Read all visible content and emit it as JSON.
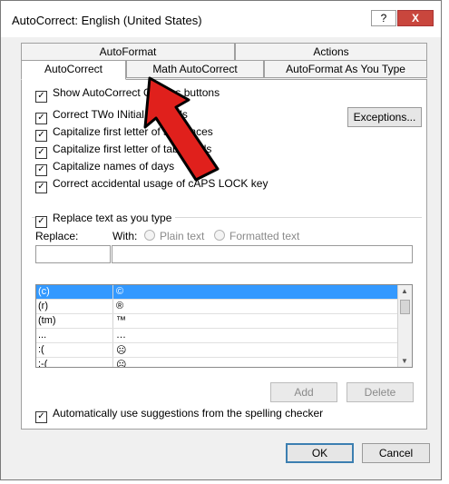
{
  "window": {
    "title": "AutoCorrect: English (United States)",
    "help_label": "?",
    "close_label": "X"
  },
  "tabs": {
    "back_row": [
      {
        "label": "AutoFormat"
      },
      {
        "label": "Actions"
      }
    ],
    "front_row": [
      {
        "label": "AutoCorrect"
      },
      {
        "label": "Math AutoCorrect"
      },
      {
        "label": "AutoFormat As You Type"
      }
    ]
  },
  "options": [
    {
      "label": "Show AutoCorrect Options buttons",
      "checked": true
    },
    {
      "label": "Correct TWo INitial CApitals",
      "checked": true
    },
    {
      "label": "Capitalize first letter of sentences",
      "checked": true
    },
    {
      "label": "Capitalize first letter of table cells",
      "checked": true
    },
    {
      "label": "Capitalize names of days",
      "checked": true
    },
    {
      "label": "Correct accidental usage of cAPS LOCK key",
      "checked": true
    }
  ],
  "exceptions_label": "Exceptions...",
  "replace_group": {
    "checkbox_label": "Replace text as you type",
    "checked": true,
    "replace_label": "Replace:",
    "with_label": "With:",
    "plain_text_label": "Plain text",
    "formatted_text_label": "Formatted text",
    "replace_value": "",
    "with_value": ""
  },
  "list_rows": [
    {
      "key": "(c)",
      "value": "©"
    },
    {
      "key": "(r)",
      "value": "®"
    },
    {
      "key": "(tm)",
      "value": "™"
    },
    {
      "key": "...",
      "value": "…"
    },
    {
      "key": ":(",
      "value": "☹"
    },
    {
      "key": ":-(",
      "value": "☹"
    }
  ],
  "buttons": {
    "add": "Add",
    "delete": "Delete",
    "ok": "OK",
    "cancel": "Cancel"
  },
  "spelling_checkbox": {
    "label": "Automatically use suggestions from the spelling checker",
    "checked": true
  },
  "colors": {
    "selection": "#3399ff",
    "arrow": "#e0201c",
    "close": "#c9463d"
  }
}
